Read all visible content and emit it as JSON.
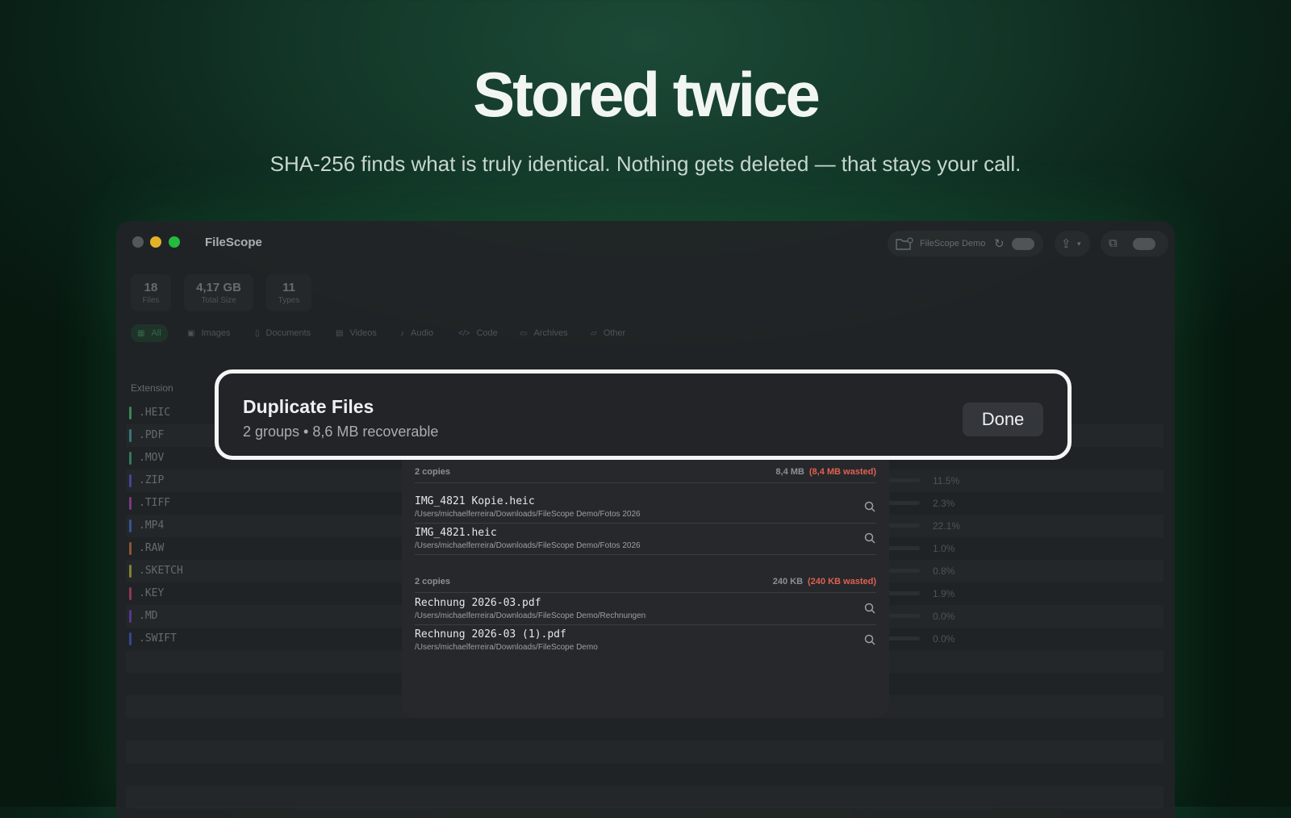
{
  "hero": {
    "title": "Stored twice",
    "subtitle": "SHA-256 finds what is truly identical. Nothing gets deleted — that stays your call."
  },
  "window": {
    "app_title": "FileScope",
    "toolbar": {
      "folder_name": "FileScope Demo"
    }
  },
  "stats": [
    {
      "value": "18",
      "label": "Files"
    },
    {
      "value": "4,17 GB",
      "label": "Total Size"
    },
    {
      "value": "11",
      "label": "Types"
    }
  ],
  "filters": [
    {
      "label": "All",
      "icon": "grid-icon",
      "active": true
    },
    {
      "label": "Images",
      "icon": "image-icon"
    },
    {
      "label": "Documents",
      "icon": "document-icon"
    },
    {
      "label": "Videos",
      "icon": "film-icon"
    },
    {
      "label": "Audio",
      "icon": "music-note-icon"
    },
    {
      "label": "Code",
      "icon": "code-brackets-icon"
    },
    {
      "label": "Archives",
      "icon": "archive-box-icon"
    },
    {
      "label": "Other",
      "icon": "folder-icon"
    }
  ],
  "table": {
    "column_extension": "Extension",
    "rows": [
      {
        "ext": ".HEIC",
        "color": "#3f8f5f",
        "pct": "",
        "fraction": 0.0
      },
      {
        "ext": ".PDF",
        "color": "#3f7f7f",
        "pct": "",
        "fraction": 0.0
      },
      {
        "ext": ".MOV",
        "color": "#3a7f66",
        "pct": "",
        "fraction": 0.59
      },
      {
        "ext": ".ZIP",
        "color": "#4a4aa0",
        "pct": "11.5%",
        "fraction": 0.115
      },
      {
        "ext": ".TIFF",
        "color": "#8a3a8a",
        "pct": "2.3%",
        "fraction": 0.023
      },
      {
        "ext": ".MP4",
        "color": "#3a5a9a",
        "pct": "22.1%",
        "fraction": 0.221
      },
      {
        "ext": ".RAW",
        "color": "#9a5a3a",
        "pct": "1.0%",
        "fraction": 0.01
      },
      {
        "ext": ".SKETCH",
        "color": "#8a8a3a",
        "pct": "0.8%",
        "fraction": 0.008
      },
      {
        "ext": ".KEY",
        "color": "#9a3a5a",
        "pct": "1.9%",
        "fraction": 0.019
      },
      {
        "ext": ".MD",
        "color": "#5a3a9a",
        "pct": "0.0%",
        "fraction": 0.0
      },
      {
        "ext": ".SWIFT",
        "color": "#3a4a9a",
        "pct": "0.0%",
        "fraction": 0.0
      }
    ]
  },
  "banner": {
    "title": "Duplicate Files",
    "subtitle": "2 groups • 8,6 MB recoverable",
    "done_label": "Done"
  },
  "duplicates": {
    "groups": [
      {
        "copies": "2 copies",
        "size": "8,4 MB",
        "wasted": "(8,4 MB wasted)",
        "files": [
          {
            "name": "IMG_4821 Kopie.heic",
            "path": "/Users/michaelferreira/Downloads/FileScope Demo/Fotos 2026"
          },
          {
            "name": "IMG_4821.heic",
            "path": "/Users/michaelferreira/Downloads/FileScope Demo/Fotos 2026"
          }
        ]
      },
      {
        "copies": "2 copies",
        "size": "240 KB",
        "wasted": "(240 KB wasted)",
        "files": [
          {
            "name": "Rechnung 2026-03.pdf",
            "path": "/Users/michaelferreira/Downloads/FileScope Demo/Rechnungen"
          },
          {
            "name": "Rechnung 2026-03 (1).pdf",
            "path": "/Users/michaelferreira/Downloads/FileScope Demo"
          }
        ]
      }
    ]
  },
  "colors": {
    "accent_green": "#28c840",
    "wasted_red": "#e0614f",
    "banner_border": "#f4f6f5"
  }
}
